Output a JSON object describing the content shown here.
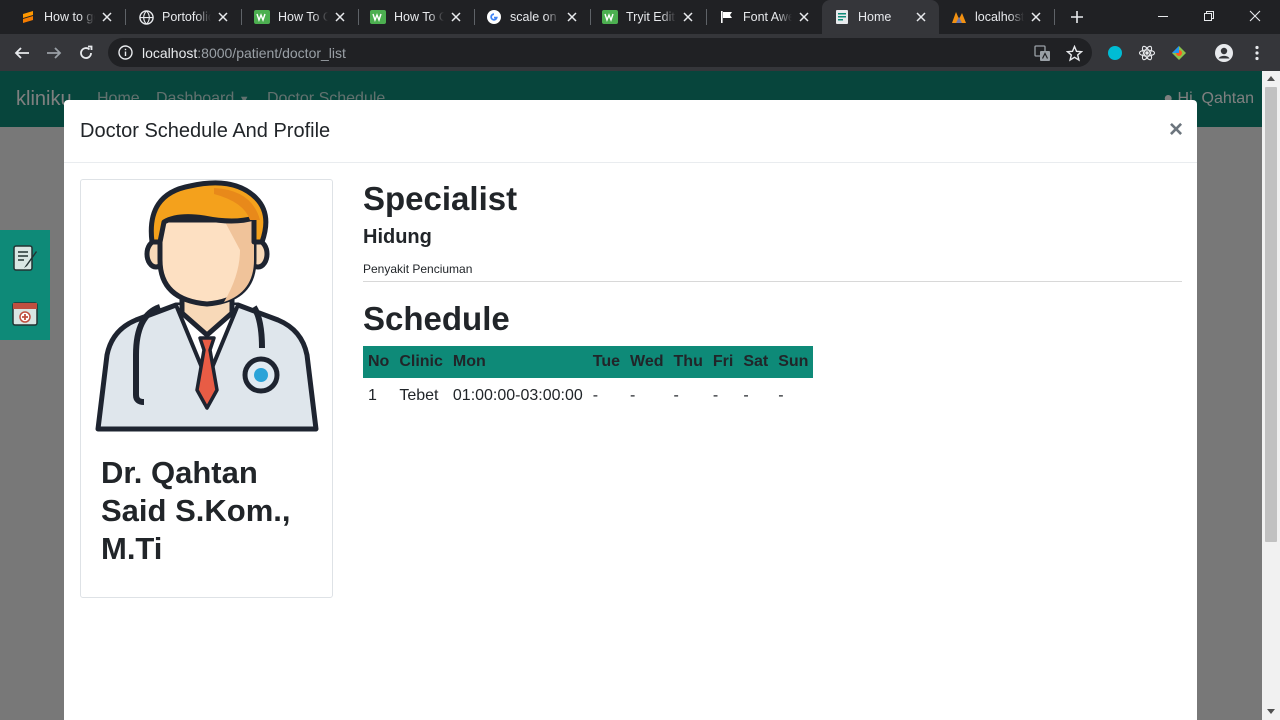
{
  "browser": {
    "tabs": [
      {
        "label": "How to get",
        "icon": "sublime-icon"
      },
      {
        "label": "Portofolio",
        "icon": "globe-icon"
      },
      {
        "label": "How To Cr",
        "icon": "w3-icon"
      },
      {
        "label": "How To Cr",
        "icon": "w3-icon"
      },
      {
        "label": "scale on h",
        "icon": "google-icon"
      },
      {
        "label": "Tryit Edito",
        "icon": "w3-icon"
      },
      {
        "label": "Font Aweso",
        "icon": "flag-icon"
      },
      {
        "label": "Home",
        "icon": "doc-icon"
      },
      {
        "label": "localhost",
        "icon": "phpmyadmin-icon"
      }
    ],
    "active_tab_index": 7,
    "url_host": "localhost",
    "url_path": ":8000/patient/doctor_list"
  },
  "site": {
    "brand": "kliniku",
    "nav": [
      "Home",
      "Dashboard",
      "Doctor Schedule"
    ],
    "greeting": "Hi, Qahtan"
  },
  "modal": {
    "title": "Doctor Schedule And Profile",
    "close": "×",
    "doctor_name": "Dr. Qahtan Said S.Kom., M.Ti",
    "specialist_heading": "Specialist",
    "specialist_name": "Hidung",
    "specialist_desc": "Penyakit Penciuman",
    "schedule_heading": "Schedule",
    "table": {
      "headers": [
        "No",
        "Clinic",
        "Mon",
        "Tue",
        "Wed",
        "Thu",
        "Fri",
        "Sat",
        "Sun"
      ],
      "rows": [
        [
          "1",
          "Tebet",
          "01:00:00-03:00:00",
          "-",
          "-",
          "-",
          "-",
          "-",
          "-"
        ]
      ]
    }
  },
  "colors": {
    "brand": "#0e8a78",
    "chrome_dark": "#202124",
    "chrome_toolbar": "#35363a"
  }
}
